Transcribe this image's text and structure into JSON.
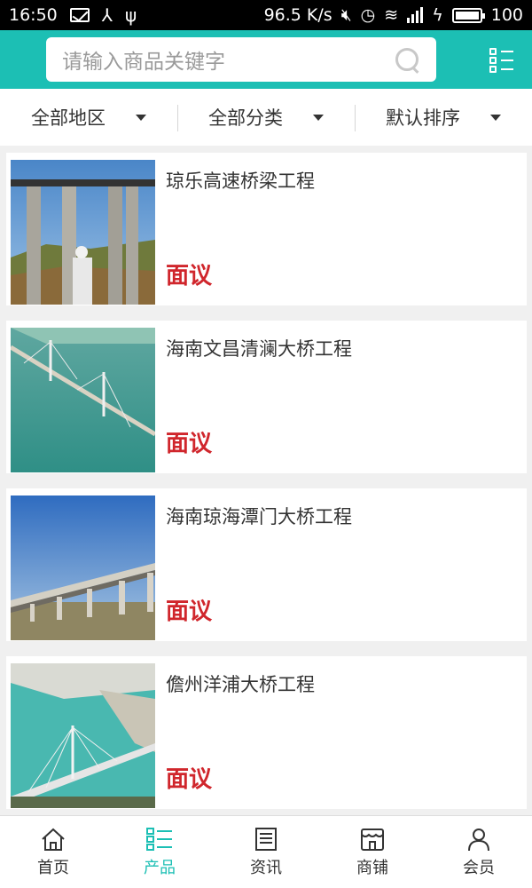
{
  "status_bar": {
    "time": "16:50",
    "speed": "96.5 K/s",
    "network": "4G",
    "battery": "100"
  },
  "search": {
    "placeholder": "请输入商品关键字"
  },
  "filters": [
    {
      "label": "全部地区"
    },
    {
      "label": "全部分类"
    },
    {
      "label": "默认排序"
    }
  ],
  "products": [
    {
      "title": "琼乐高速桥梁工程",
      "price": "面议"
    },
    {
      "title": "海南文昌清澜大桥工程",
      "price": "面议"
    },
    {
      "title": "海南琼海潭门大桥工程",
      "price": "面议"
    },
    {
      "title": "儋州洋浦大桥工程",
      "price": "面议"
    }
  ],
  "bottom_nav": [
    {
      "label": "首页",
      "icon": "home-icon"
    },
    {
      "label": "产品",
      "icon": "product-list-icon",
      "active": true
    },
    {
      "label": "资讯",
      "icon": "news-icon"
    },
    {
      "label": "商铺",
      "icon": "shop-icon"
    },
    {
      "label": "会员",
      "icon": "member-icon"
    }
  ],
  "colors": {
    "brand": "#1cbfb4",
    "price": "#d0262c"
  }
}
